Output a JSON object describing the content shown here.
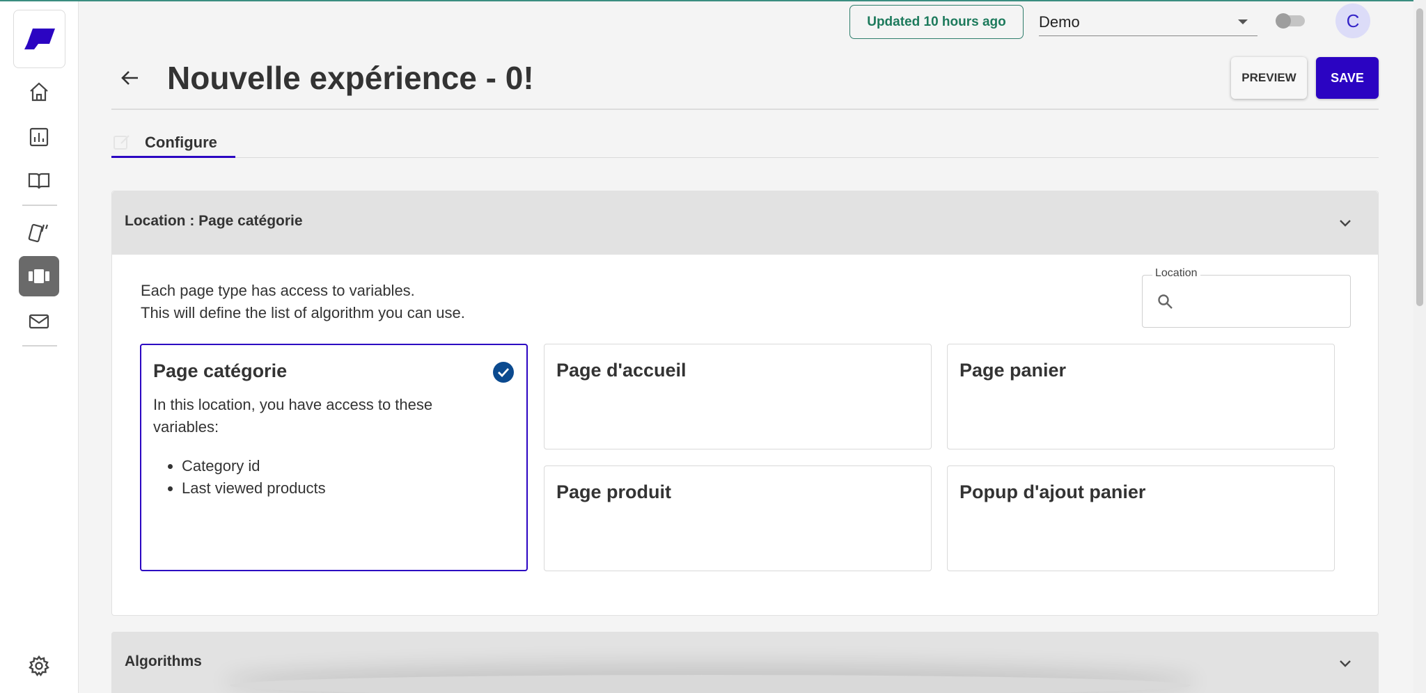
{
  "header": {
    "updated_text": "Updated 10 hours ago",
    "project_selected": "Demo",
    "avatar_initial": "C"
  },
  "page": {
    "title": "Nouvelle expérience - 0!",
    "preview_label": "PREVIEW",
    "save_label": "SAVE"
  },
  "tabs": [
    {
      "label": "Configure",
      "active": true
    }
  ],
  "location_section": {
    "title": "Location : Page catégorie",
    "description_line1": "Each page type has access to variables.",
    "description_line2": "This will define the list of algorithm you can use.",
    "search_label": "Location",
    "search_value": "",
    "cards": [
      {
        "title": "Page catégorie",
        "selected": true,
        "text": "In this location, you have access to these variables:",
        "variables": [
          "Category id",
          "Last viewed products"
        ]
      },
      {
        "title": "Page d'accueil",
        "selected": false
      },
      {
        "title": "Page panier",
        "selected": false
      },
      {
        "title": "Page produit",
        "selected": false
      },
      {
        "title": "Popup d'ajout panier",
        "selected": false
      }
    ]
  },
  "algorithms_section": {
    "title": "Algorithms"
  },
  "sidebar": {
    "items": [
      {
        "icon": "home-icon"
      },
      {
        "icon": "analytics-icon"
      },
      {
        "icon": "book-icon"
      },
      {
        "icon": "cards-icon"
      },
      {
        "icon": "carousel-icon",
        "active": true
      },
      {
        "icon": "mail-icon"
      },
      {
        "icon": "settings-icon"
      }
    ]
  },
  "colors": {
    "accent": "#2b04c2",
    "updated_green": "#1d7a5c",
    "check_blue": "#0b4a8f",
    "active_nav": "#6a6a6a"
  }
}
